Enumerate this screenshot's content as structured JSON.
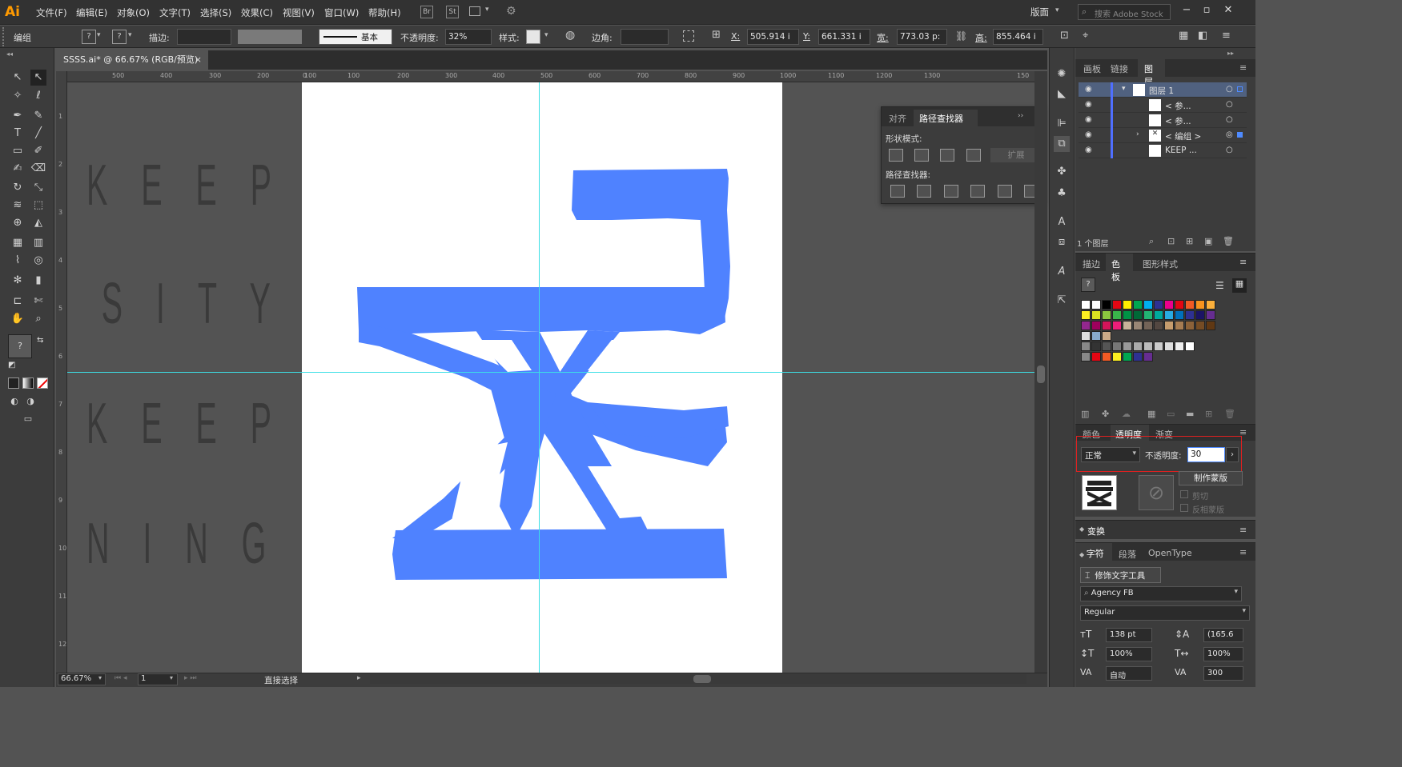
{
  "app": {
    "logo": "Ai"
  },
  "menu": [
    "文件(F)",
    "编辑(E)",
    "对象(O)",
    "文字(T)",
    "选择(S)",
    "效果(C)",
    "视图(V)",
    "窗口(W)",
    "帮助(H)"
  ],
  "menubar_icons": {
    "br": "Br",
    "st": "St"
  },
  "workspace": {
    "label": "版面",
    "search_placeholder": "搜索 Adobe Stock"
  },
  "control_bar": {
    "selection_label": "编组",
    "stroke_label": "描边:",
    "brush_label": "基本",
    "opacity_label": "不透明度:",
    "opacity_value": "32%",
    "style_label": "样式:",
    "corner_label": "边角:",
    "x_label": "X:",
    "x_value": "505.914 i",
    "y_label": "Y:",
    "y_value": "661.331 i",
    "w_label": "宽:",
    "w_value": "773.03 p:",
    "h_label": "高:",
    "h_value": "855.464 i"
  },
  "document": {
    "tab_title": "SSSS.ai* @ 66.67% (RGB/预览)",
    "close": "×"
  },
  "ruler_h": [
    "500",
    "400",
    "300",
    "200",
    "100",
    "0",
    "100",
    "200",
    "300",
    "400",
    "500",
    "600",
    "700",
    "800",
    "900",
    "1000",
    "1100",
    "1200",
    "1300",
    "150"
  ],
  "ruler_v": [
    "1",
    "2",
    "3",
    "4",
    "5",
    "6",
    "7",
    "8",
    "9",
    "10",
    "11",
    "12"
  ],
  "canvas_text": [
    "K E E P",
    "O S I T Y",
    "K E E P",
    "N I N G"
  ],
  "pathfinder": {
    "tab_align": "对齐",
    "tab_pathfinder": "路径查找器",
    "shape_modes": "形状模式:",
    "expand": "扩展",
    "pathfinders": "路径查找器:"
  },
  "layers_panel": {
    "tabs": [
      "画板",
      "链接",
      "图层"
    ],
    "rows": [
      "图层 1",
      "< 参...",
      "< 参...",
      "< 编组 >",
      "KEEP ..."
    ],
    "footer": "1 个图层"
  },
  "swatches_panel": {
    "tabs": [
      "描边",
      "色板",
      "图形样式"
    ]
  },
  "transparency_panel": {
    "tabs": [
      "颜色",
      "透明度",
      "渐变"
    ],
    "blend_mode": "正常",
    "opacity_label": "不透明度:",
    "opacity_value": "30",
    "make_mask": "制作蒙版",
    "clip": "剪切",
    "invert_mask": "反相蒙版"
  },
  "transform_panel": {
    "label": "变换"
  },
  "character_panel": {
    "tabs": [
      "字符",
      "段落",
      "OpenType"
    ],
    "touch_type": "修饰文字工具",
    "font_family": "Agency FB",
    "font_style": "Regular",
    "size": "138 pt",
    "leading": "(165.6",
    "h_scale": "100%",
    "v_scale": "100%",
    "kerning": "自动",
    "tracking": "300"
  },
  "status": {
    "zoom": "66.67%",
    "page": "1",
    "tool": "直接选择"
  },
  "colors": {
    "accent_blue": "#4f82ff",
    "guide": "#3cdfe6",
    "highlight_red": "#e02020",
    "ai_orange": "#ff9a00"
  }
}
